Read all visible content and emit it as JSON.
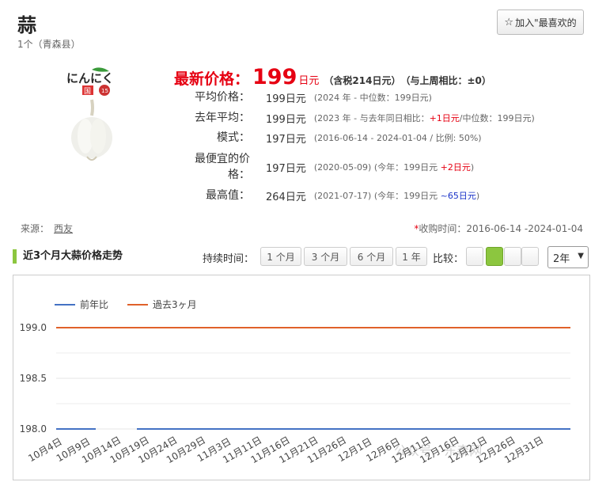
{
  "product": {
    "name": "蒜",
    "spec": "1个（青森县）",
    "favorite_label": "加入\"最喜欢的"
  },
  "price": {
    "latest_label": "最新价格：",
    "latest_value": "199",
    "unit": "日元",
    "tax_note": "（含税214日元）",
    "week_note": "（与上周相比：±0）"
  },
  "stats": [
    {
      "key": "平均价格：",
      "value": "199日元",
      "note": "(2024 年 - 中位数：199日元)",
      "extra": "",
      "extra_tail": ""
    },
    {
      "key": "去年平均：",
      "value": "199日元",
      "note": "(2023 年 - 与去年同日相比：",
      "extra": "+1日元",
      "extra_tail": "/中位数：199日元)"
    },
    {
      "key": "模式：",
      "value": "197日元",
      "note": "(2016-06-14 - 2024-01-04 / 比例: 50%)",
      "extra": "",
      "extra_tail": ""
    },
    {
      "key": "最便宜的价格：",
      "value": "197日元",
      "note": "(2020-05-09) (今年：199日元 ",
      "extra": "+2日元",
      "extra_tail": ")"
    },
    {
      "key": "最高值：",
      "value": "264日元",
      "note": "(2021-07-17) (今年：199日元 ",
      "extra": "~65日元",
      "extra_tail": ")"
    }
  ],
  "source": {
    "label": "来源：",
    "link": "西友"
  },
  "period": {
    "asterisk": "*",
    "text": "收购时间：2016-06-14 -2024-01-04"
  },
  "section_title": "近3个月大蒜价格走势",
  "controls": {
    "duration_label": "持续时间：",
    "durations": [
      "1 个月",
      "3 个月",
      "6 个月",
      "1 年"
    ],
    "compare_label": "比较：",
    "year_value": "2年"
  },
  "colors": {
    "accent_green": "#8cc63f",
    "price_red": "#e60012",
    "series_blue": "#4472c4",
    "series_orange": "#e0612a"
  },
  "chart_data": {
    "type": "line",
    "x": [
      "10月4日",
      "10月9日",
      "10月14日",
      "10月19日",
      "10月24日",
      "10月29日",
      "11月3日",
      "11月11日",
      "11月16日",
      "11月21日",
      "11月26日",
      "12月1日",
      "12月6日",
      "12月11日",
      "12月16日",
      "12月21日",
      "12月26日",
      "12月31日"
    ],
    "series": [
      {
        "name": "前年比",
        "color": "#4472c4",
        "values": [
          198.0,
          198.0,
          198.0,
          198.0,
          198.0,
          198.0,
          198.0,
          198.0,
          198.0,
          198.0,
          198.0,
          198.0,
          198.0,
          198.0,
          198.0,
          198.0,
          198.0,
          198.0
        ]
      },
      {
        "name": "過去3ヶ月",
        "color": "#e0612a",
        "values": [
          199.0,
          199.0,
          199.0,
          199.0,
          199.0,
          199.0,
          199.0,
          199.0,
          199.0,
          199.0,
          199.0,
          199.0,
          199.0,
          199.0,
          199.0,
          199.0,
          199.0,
          199.0
        ]
      }
    ],
    "yticks": [
      "199.0",
      "198.5",
      "198.0"
    ],
    "ylim": [
      198.0,
      199.0
    ],
    "legend": "top-left",
    "grid": true
  },
  "watermark": "公众号 · 东森网"
}
